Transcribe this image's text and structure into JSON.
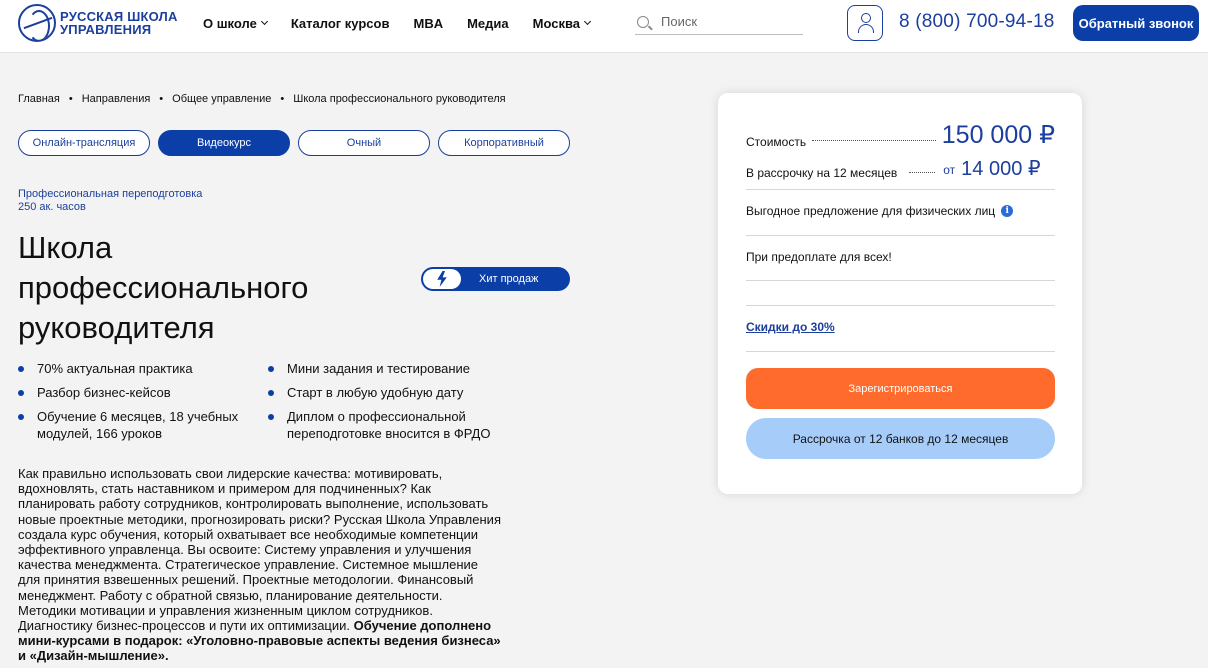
{
  "header": {
    "logo_line1": "РУССКАЯ ШКОЛА",
    "logo_line2": "УПРАВЛЕНИЯ",
    "nav": [
      {
        "label": "О школе",
        "has_dropdown": true
      },
      {
        "label": "Каталог курсов",
        "has_dropdown": false
      },
      {
        "label": "MBA",
        "has_dropdown": false
      },
      {
        "label": "Медиа",
        "has_dropdown": false
      },
      {
        "label": "Москва",
        "has_dropdown": true
      }
    ],
    "search_placeholder": "Поиск",
    "phone": "8 (800) 700-94-18",
    "callback_label": "Обратный звонок"
  },
  "breadcrumb": [
    "Главная",
    "Направления",
    "Общее управление",
    "Школа профессионального руководителя"
  ],
  "breadcrumb_sep": "•",
  "formats": [
    {
      "label": "Онлайн-трансляция",
      "active": false
    },
    {
      "label": "Видеокурс",
      "active": true
    },
    {
      "label": "Очный",
      "active": false
    },
    {
      "label": "Корпоративный",
      "active": false
    }
  ],
  "program": {
    "type": "Профессиональная переподготовка",
    "hours": "250 ак. часов",
    "title": "Школа профессионального руководителя",
    "badge": "Хит продаж"
  },
  "features": [
    "70% актуальная практика",
    "Разбор бизнес-кейсов",
    "Обучение 6 месяцев, 18 учебных модулей, 166 уроков",
    "Мини задания и тестирование",
    "Старт в любую удобную дату",
    "Диплом о профессиональной переподготовке вносится в ФРДО"
  ],
  "description": {
    "text": "Как правильно использовать свои лидерские качества: мотивировать, вдохновлять, стать наставником и примером для подчиненных? Как планировать работу сотрудников, контролировать выполнение, использовать новые проектные методики, прогнозировать риски? Русская Школа Управления создала курс обучения, который охватывает все необходимые компетенции эффективного управленца. Вы освоите: Систему управления и улучшения качества менеджмента. Стратегическое управление. Системное мышление для принятия взвешенных решений. Проектные методологии. Финансовый менеджмент. Работу с обратной связью, планирование деятельности. Методики мотивации и управления жизненным циклом сотрудников. Диагностику бизнес-процессов и пути их оптимизации. ",
    "bold": "Обучение дополнено мини-курсами в подарок: «Уголовно-правовые аспекты ведения бизнеса» и «Дизайн-мышление»."
  },
  "card": {
    "price_label": "Стоимость",
    "price": "150 000 ₽",
    "installment_label": "В рассрочку на 12 месяцев",
    "installment_from": "от",
    "installment_price": "14 000 ₽",
    "offer": "Выгодное предложение для физических лиц",
    "info_icon": "i",
    "prepay": "При предоплате для всех!",
    "discount": "Скидки до 30%",
    "register_label": "Зарегистрироваться",
    "installment_button": "Рассрочка от 12 банков до 12 месяцев"
  },
  "colors": {
    "brand_blue": "#0c3ea8",
    "accent_orange": "#ff6b2c",
    "light_blue": "#a6cdfa"
  }
}
